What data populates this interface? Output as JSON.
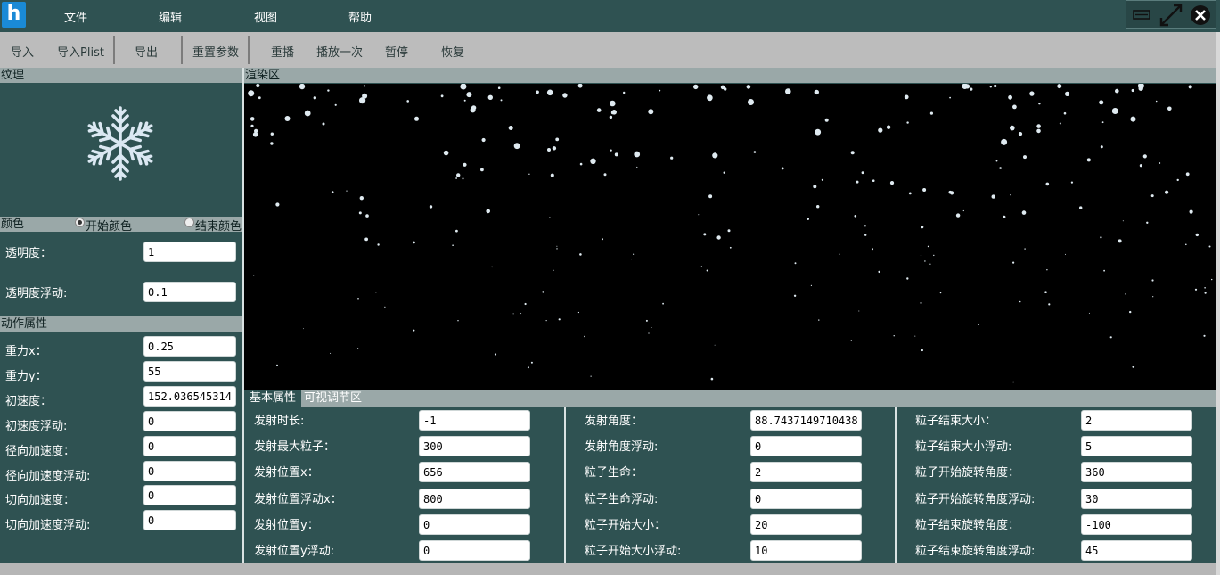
{
  "app": {
    "logo_letter": "h"
  },
  "menu": [
    "文件",
    "编辑",
    "视图",
    "帮助"
  ],
  "toolbar": [
    "导入",
    "导入Plist",
    "导出",
    "重置参数",
    "重播",
    "播放一次",
    "暂停",
    "恢复"
  ],
  "left": {
    "texture_header": "纹理",
    "texture_icon": "snowflake-icon",
    "color_header": "颜色",
    "start_color": "开始颜色",
    "end_color": "结束颜色",
    "opacity_label": "透明度：",
    "opacity_value": "1",
    "opacity_var_label": "透明度浮动:",
    "opacity_var_value": "0.1",
    "motion_header": "动作属性",
    "motion": [
      {
        "label": "重力x：",
        "value": "0.25"
      },
      {
        "label": "重力y：",
        "value": "55"
      },
      {
        "label": "初速度：",
        "value": "152.036545314"
      },
      {
        "label": "初速度浮动:",
        "value": "0"
      },
      {
        "label": "径向加速度：",
        "value": "0"
      },
      {
        "label": "径向加速度浮动:",
        "value": "0"
      },
      {
        "label": "切向加速度：",
        "value": "0"
      },
      {
        "label": "切向加速度浮动:",
        "value": "0"
      }
    ]
  },
  "render": {
    "header": "渲染区"
  },
  "tabs": [
    "基本属性",
    "可视调节区"
  ],
  "params": {
    "col1": [
      {
        "label": "发射时长:",
        "value": "-1"
      },
      {
        "label": "发射最大粒子：",
        "value": "300"
      },
      {
        "label": "发射位置x：",
        "value": "656"
      },
      {
        "label": "发射位置浮动x：",
        "value": "800"
      },
      {
        "label": "发射位置y：",
        "value": "0"
      },
      {
        "label": "发射位置y浮动:",
        "value": "0"
      }
    ],
    "col2": [
      {
        "label": "发射角度：",
        "value": "88.7437149710438"
      },
      {
        "label": "发射角度浮动:",
        "value": "0"
      },
      {
        "label": "粒子生命：",
        "value": "2"
      },
      {
        "label": "粒子生命浮动:",
        "value": "0"
      },
      {
        "label": "粒子开始大小：",
        "value": "20"
      },
      {
        "label": "粒子开始大小浮动:",
        "value": "10"
      }
    ],
    "col3": [
      {
        "label": "粒子结束大小：",
        "value": "2"
      },
      {
        "label": "粒子结束大小浮动:",
        "value": "5"
      },
      {
        "label": "粒子开始旋转角度：",
        "value": "360"
      },
      {
        "label": "粒子开始旋转角度浮动:",
        "value": "30"
      },
      {
        "label": "粒子结束旋转角度：",
        "value": "-100"
      },
      {
        "label": "粒子结束旋转角度浮动:",
        "value": "45"
      }
    ]
  }
}
